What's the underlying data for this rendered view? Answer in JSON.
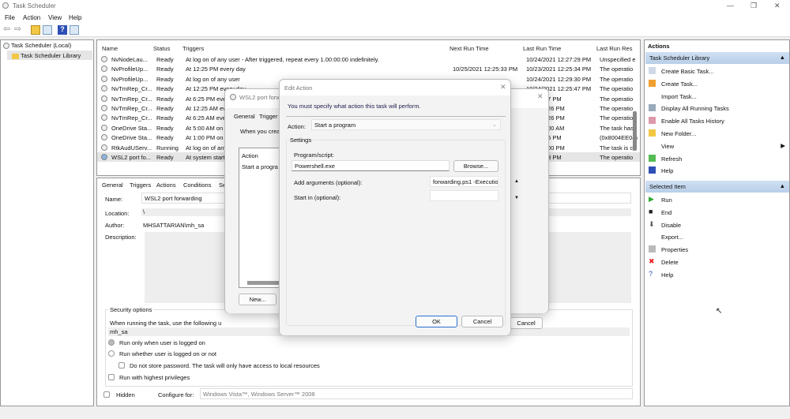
{
  "window": {
    "title": "Task Scheduler"
  },
  "menu": [
    "File",
    "Action",
    "View",
    "Help"
  ],
  "tree": {
    "root": "Task Scheduler (Local)",
    "library": "Task Scheduler Library"
  },
  "task_list": {
    "columns": [
      "Name",
      "Status",
      "Triggers",
      "Next Run Time",
      "Last Run Time",
      "Last Run Res"
    ],
    "rows": [
      {
        "name": "NvNodeLau...",
        "status": "Ready",
        "trigger": "At log on of any user - After triggered, repeat every 1.00:00:00 indefinitely.",
        "next": "",
        "last": "10/24/2021 12:27:29 PM",
        "result": "Unspecified e"
      },
      {
        "name": "NvProfileUp...",
        "status": "Ready",
        "trigger": "At 12:25 PM every day",
        "next": "10/25/2021 12:25:33 PM",
        "last": "10/23/2021 12:25:34 PM",
        "result": "The operatio"
      },
      {
        "name": "NvProfileUp...",
        "status": "Ready",
        "trigger": "At log on of any user",
        "next": "",
        "last": "10/24/2021 12:29:30 PM",
        "result": "The operatio"
      },
      {
        "name": "NvTmRep_Cr...",
        "status": "Ready",
        "trigger": "At 12:25 PM every day",
        "next": "",
        "last": "10/24/2021 12:25:47 PM",
        "result": "The operatio"
      },
      {
        "name": "NvTmRep_Cr...",
        "status": "Ready",
        "trigger": "At 6:25 PM every day",
        "next": "",
        "last": "1 6:25:47 PM",
        "result": "The operatio"
      },
      {
        "name": "NvTmRep_Cr...",
        "status": "Ready",
        "trigger": "At 12:25 AM every day",
        "next": "",
        "last": "1 12:33:26 PM",
        "result": "The operatio"
      },
      {
        "name": "NvTmRep_Cr...",
        "status": "Ready",
        "trigger": "At 6:25 AM every day",
        "next": "",
        "last": "1 12:33:26 PM",
        "result": "The operatio"
      },
      {
        "name": "OneDrive Sta...",
        "status": "Ready",
        "trigger": "At 5:00 AM on 5/",
        "next": "",
        "last": "9 12:00:00 AM",
        "result": "The task has"
      },
      {
        "name": "OneDrive Sta...",
        "status": "Ready",
        "trigger": "At 1:00 PM on 5/",
        "next": "",
        "last": "1 2:09:35 PM",
        "result": "(0x8004EE04)"
      },
      {
        "name": "RtkAudUServ...",
        "status": "Running",
        "trigger": "At log on of any user",
        "next": "",
        "last": "1 12:28:00 PM",
        "result": "The task is c"
      },
      {
        "name": "WSL2 port fo...",
        "status": "Ready",
        "trigger": "At system startup",
        "next": "",
        "last": "1 3:58:23 PM",
        "result": "The operatio"
      }
    ]
  },
  "details": {
    "tabs": [
      "General",
      "Triggers",
      "Actions",
      "Conditions",
      "Se"
    ],
    "name_label": "Name:",
    "name": "WSL2 port forwarding",
    "location_label": "Location:",
    "location": "\\",
    "author_label": "Author:",
    "author": "MHSATTARIAN\\mh_sa",
    "description_label": "Description:",
    "security_title": "Security options",
    "security_text": "When running the task, use the following u",
    "user": "mh_sa",
    "opt_logged_on": "Run only when user is logged on",
    "opt_whether": "Run whether user is logged on or not",
    "opt_no_store": "Do not store password.  The task will only have access to local resources",
    "opt_highest": "Run with highest privileges",
    "hidden": "Hidden",
    "configure_label": "Configure for:",
    "configure_value": "Windows Vista™, Windows Server™ 2008"
  },
  "props_dialog": {
    "title": "WSL2 port forw",
    "tabs": [
      "General",
      "Trigger"
    ],
    "intro": "When you crea",
    "col_action": "Action",
    "row_action": "Start a progra",
    "new_button": "New...",
    "cancel_button": "Cancel"
  },
  "edit_action": {
    "title": "Edit Action",
    "instruction": "You must specify what action this task will perform.",
    "action_label": "Action:",
    "action_value": "Start a program",
    "settings": "Settings",
    "program_label": "Program/script:",
    "program_value": "Powershell.exe",
    "browse": "Browse...",
    "args_label": "Add arguments (optional):",
    "args_value": "forwarding.ps1 -Execution",
    "start_label": "Start in (optional):",
    "start_value": "",
    "ok": "OK",
    "cancel": "Cancel"
  },
  "actions_pane": {
    "title": "Actions",
    "section1": "Task Scheduler Library",
    "items1": [
      "Create Basic Task...",
      "Create Task...",
      "Import Task...",
      "Display All Running Tasks",
      "Enable All Tasks History",
      "New Folder...",
      "View",
      "Refresh",
      "Help"
    ],
    "section2": "Selected Item",
    "items2": [
      "Run",
      "End",
      "Disable",
      "Export...",
      "Properties",
      "Delete",
      "Help"
    ]
  }
}
